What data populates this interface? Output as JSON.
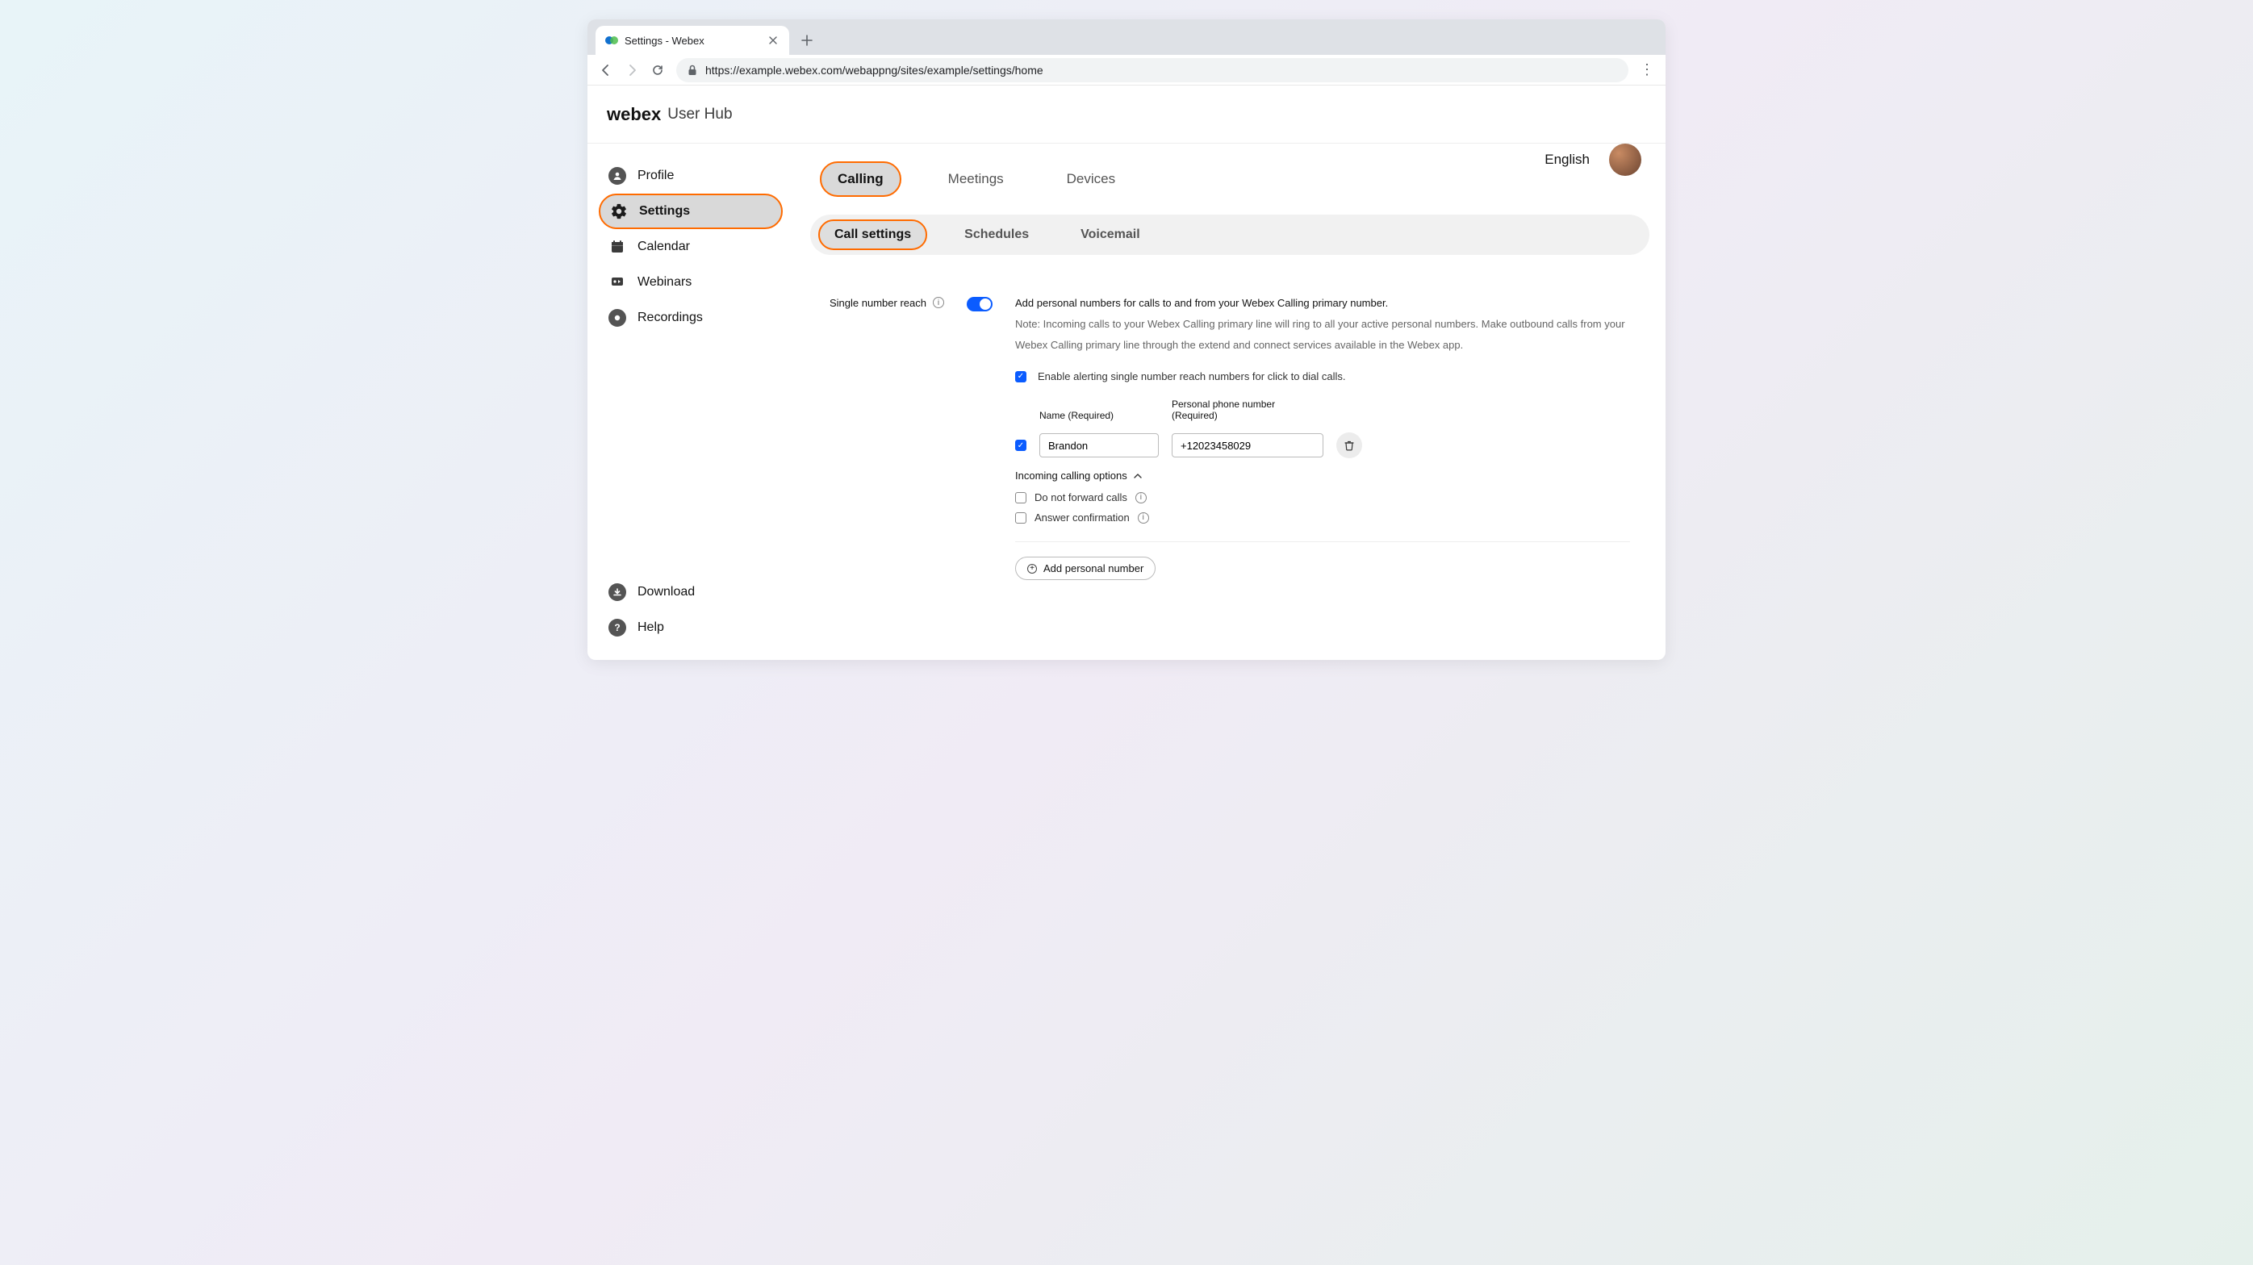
{
  "browser": {
    "tab_title": "Settings - Webex",
    "url": "https://example.webex.com/webappng/sites/example/settings/home"
  },
  "header": {
    "brand": "webex",
    "subtitle": "User Hub",
    "language": "English"
  },
  "sidebar": {
    "items": [
      {
        "label": "Profile"
      },
      {
        "label": "Settings"
      },
      {
        "label": "Calendar"
      },
      {
        "label": "Webinars"
      },
      {
        "label": "Recordings"
      }
    ],
    "footer": [
      {
        "label": "Download"
      },
      {
        "label": "Help"
      }
    ]
  },
  "tabs": {
    "primary": [
      "Calling",
      "Meetings",
      "Devices"
    ],
    "secondary": [
      "Call settings",
      "Schedules",
      "Voicemail"
    ]
  },
  "snr": {
    "title": "Single number reach",
    "desc": "Add personal numbers for calls to and from your Webex Calling primary number.",
    "note": "Note: Incoming calls to your Webex Calling primary line will ring to all your active personal numbers. Make outbound calls from your Webex Calling primary line through the extend and connect services available in the Webex app.",
    "alerting_label": "Enable alerting single number reach numbers for click to dial calls.",
    "name_label": "Name (Required)",
    "phone_label": "Personal phone number (Required)",
    "name_value": "Brandon",
    "phone_value": "+12023458029",
    "incoming_label": "Incoming calling options",
    "opt_no_forward": "Do not forward calls",
    "opt_answer_conf": "Answer confirmation",
    "add_btn": "Add personal number"
  }
}
